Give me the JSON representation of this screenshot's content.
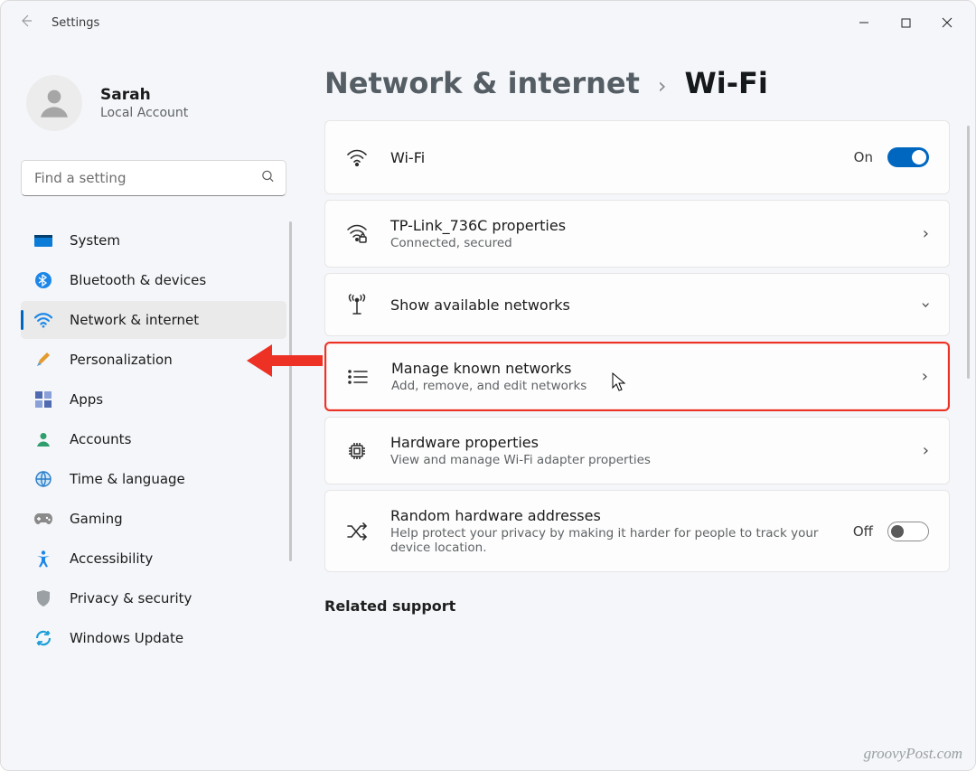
{
  "window": {
    "title": "Settings"
  },
  "user": {
    "name": "Sarah",
    "subtitle": "Local Account"
  },
  "search": {
    "placeholder": "Find a setting"
  },
  "sidebar": {
    "items": [
      {
        "id": "system",
        "label": "System"
      },
      {
        "id": "bluetooth",
        "label": "Bluetooth & devices"
      },
      {
        "id": "network",
        "label": "Network & internet"
      },
      {
        "id": "personalization",
        "label": "Personalization"
      },
      {
        "id": "apps",
        "label": "Apps"
      },
      {
        "id": "accounts",
        "label": "Accounts"
      },
      {
        "id": "time",
        "label": "Time & language"
      },
      {
        "id": "gaming",
        "label": "Gaming"
      },
      {
        "id": "accessibility",
        "label": "Accessibility"
      },
      {
        "id": "privacy",
        "label": "Privacy & security"
      },
      {
        "id": "update",
        "label": "Windows Update"
      }
    ],
    "selected_index": 2
  },
  "breadcrumb": {
    "parent": "Network & internet",
    "current": "Wi-Fi"
  },
  "cards": {
    "wifi": {
      "title": "Wi-Fi",
      "state_label": "On",
      "state": true
    },
    "connection": {
      "title": "TP-Link_736C properties",
      "subtitle": "Connected, secured"
    },
    "available": {
      "title": "Show available networks"
    },
    "known": {
      "title": "Manage known networks",
      "subtitle": "Add, remove, and edit networks"
    },
    "hardware": {
      "title": "Hardware properties",
      "subtitle": "View and manage Wi-Fi adapter properties"
    },
    "random": {
      "title": "Random hardware addresses",
      "subtitle": "Help protect your privacy by making it harder for people to track your device location.",
      "state_label": "Off",
      "state": false
    }
  },
  "related": {
    "heading": "Related support"
  },
  "watermark": "groovyPost.com",
  "colors": {
    "accent": "#0067c0",
    "highlight": "#ed3124"
  }
}
